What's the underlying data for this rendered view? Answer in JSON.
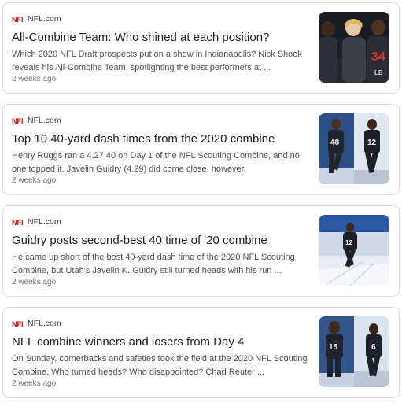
{
  "results": [
    {
      "source": "NFL.com",
      "title": "All-Combine Team: Who shined at each position?",
      "snippet": "Which 2020 NFL Draft prospects put on a show in Indianapolis? Nick Shook reveals his All-Combine Team, spotlighting the best performers at ...",
      "time": "2 weeks ago",
      "thumb_numbers": [
        "34",
        "LB"
      ]
    },
    {
      "source": "NFL.com",
      "title": "Top 10 40-yard dash times from the 2020 combine",
      "snippet": "Henry Ruggs ran a 4.27 40 on Day 1 of the NFL Scouting Combine, and no one topped it. Javelin Guidry (4.29) did come close, however.",
      "time": "2 weeks ago",
      "thumb_numbers": [
        "48",
        "12"
      ]
    },
    {
      "source": "NFL.com",
      "title": "Guidry posts second-best 40 time of '20 combine",
      "snippet": "He came up short of the best 40-yard dash time of the 2020 NFL Scouting Combine, but Utah's Javelin K. Guidry still turned heads with his run ...",
      "time": "2 weeks ago",
      "thumb_numbers": [
        "12"
      ]
    },
    {
      "source": "NFL.com",
      "title": "NFL combine winners and losers from Day 4",
      "snippet": "On Sunday, cornerbacks and safeties took the field at the 2020 NFL Scouting Combine. Who turned heads? Who disappointed? Chad Reuter ...",
      "time": "2 weeks ago",
      "thumb_numbers": [
        "15",
        "6"
      ]
    }
  ],
  "colors": {
    "nfl_red": "#d50a0a",
    "nfl_navy": "#013369",
    "title_text": "#1f1f1f",
    "snippet_text": "#4d5156",
    "meta_text": "#70757a",
    "card_border": "#dadce0"
  },
  "icons": {
    "favicon": "nfl-shield-icon"
  }
}
